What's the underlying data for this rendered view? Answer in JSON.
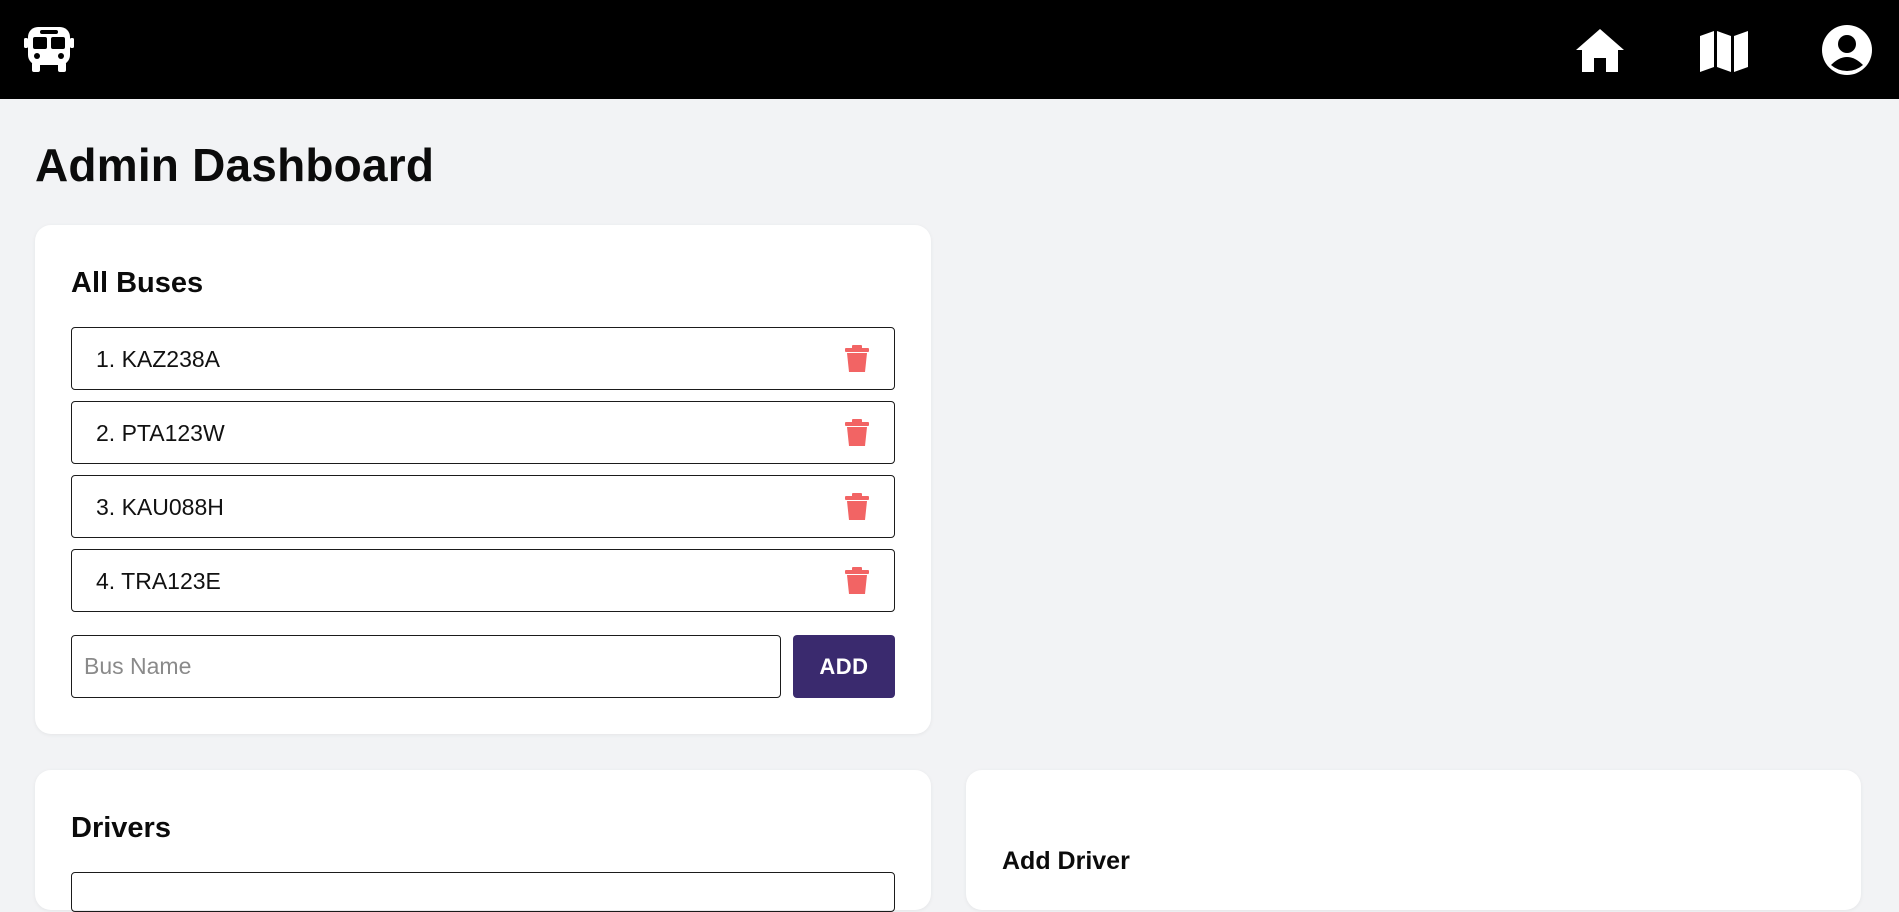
{
  "nav": {
    "brand_icon": "bus-icon",
    "items": [
      {
        "icon": "home-icon"
      },
      {
        "icon": "map-icon"
      },
      {
        "icon": "user-icon"
      }
    ]
  },
  "page": {
    "title": "Admin Dashboard"
  },
  "buses": {
    "title": "All Buses",
    "items": [
      {
        "label": "1. KAZ238A"
      },
      {
        "label": "2. PTA123W"
      },
      {
        "label": "3. KAU088H"
      },
      {
        "label": "4. TRA123E"
      }
    ],
    "input": {
      "placeholder": "Bus Name",
      "value": ""
    },
    "add_label": "ADD"
  },
  "drivers": {
    "title": "Drivers"
  },
  "add_driver": {
    "title": "Add Driver"
  },
  "colors": {
    "topbar": "#000000",
    "background": "#f2f3f5",
    "accent": "#3a2a6e",
    "delete": "#f26464"
  }
}
